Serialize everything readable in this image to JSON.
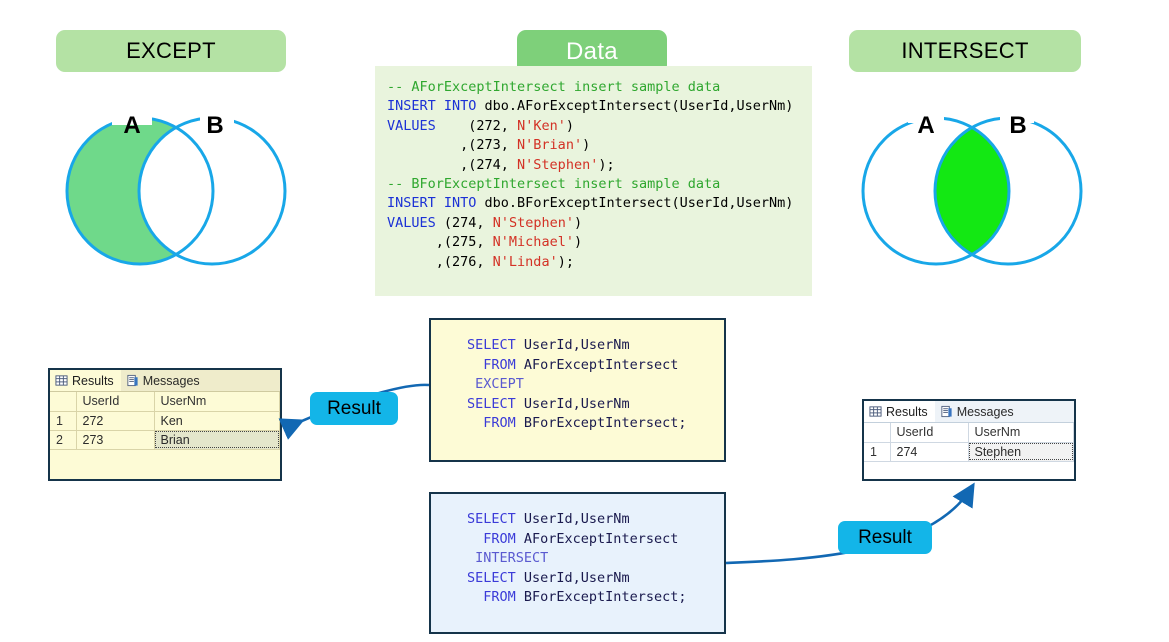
{
  "sections": {
    "except_title": "EXCEPT",
    "data_title": "Data",
    "intersect_title": "INTERSECT"
  },
  "venn": {
    "except": {
      "label_a": "A",
      "label_b": "B",
      "fill_color": "#6fd98a",
      "stroke_color": "#18a7e8",
      "shaded_region": "A only"
    },
    "intersect": {
      "label_a": "A",
      "label_b": "B",
      "fill_color": "#13e813",
      "stroke_color": "#18a7e8",
      "shaded_region": "A and B"
    }
  },
  "data_panel": {
    "background": "#e9f4dd",
    "lines": [
      [
        {
          "t": "-- AForExceptIntersect insert sample data",
          "c": "c"
        }
      ],
      [
        {
          "t": "INSERT INTO ",
          "c": "k"
        },
        {
          "t": "dbo.AForExceptIntersect(UserId,UserNm)",
          "c": "n"
        }
      ],
      [
        {
          "t": "VALUES ",
          "c": "k"
        },
        {
          "t": "   (272, ",
          "c": "n"
        },
        {
          "t": "N'Ken'",
          "c": "s"
        },
        {
          "t": ")",
          "c": "n"
        }
      ],
      [
        {
          "t": "         ,(273, ",
          "c": "n"
        },
        {
          "t": "N'Brian'",
          "c": "s"
        },
        {
          "t": ")",
          "c": "n"
        }
      ],
      [
        {
          "t": "         ,(274, ",
          "c": "n"
        },
        {
          "t": "N'Stephen'",
          "c": "s"
        },
        {
          "t": ");",
          "c": "n"
        }
      ],
      [
        {
          "t": "-- BForExceptIntersect insert sample data",
          "c": "c"
        }
      ],
      [
        {
          "t": "INSERT INTO ",
          "c": "k"
        },
        {
          "t": "dbo.BForExceptIntersect(UserId,UserNm)",
          "c": "n"
        }
      ],
      [
        {
          "t": "VALUES ",
          "c": "k"
        },
        {
          "t": "(274, ",
          "c": "n"
        },
        {
          "t": "N'Stephen'",
          "c": "s"
        },
        {
          "t": ")",
          "c": "n"
        }
      ],
      [
        {
          "t": "      ,(275, ",
          "c": "n"
        },
        {
          "t": "N'Michael'",
          "c": "s"
        },
        {
          "t": ")",
          "c": "n"
        }
      ],
      [
        {
          "t": "      ,(276, ",
          "c": "n"
        },
        {
          "t": "N'Linda'",
          "c": "s"
        },
        {
          "t": ");",
          "c": "n"
        }
      ]
    ]
  },
  "sql_except": {
    "background": "#fdfbd6",
    "border": "#15344a",
    "lines": [
      [
        {
          "t": "SELECT ",
          "c": "sk"
        },
        {
          "t": "UserId,UserNm",
          "c": "sid"
        }
      ],
      [
        {
          "t": "  FROM ",
          "c": "sk"
        },
        {
          "t": "AForExceptIntersect",
          "c": "sid"
        }
      ],
      [
        {
          "t": " EXCEPT",
          "c": "sop"
        }
      ],
      [
        {
          "t": "SELECT ",
          "c": "sk"
        },
        {
          "t": "UserId,UserNm",
          "c": "sid"
        }
      ],
      [
        {
          "t": "  FROM ",
          "c": "sk"
        },
        {
          "t": "BForExceptIntersect;",
          "c": "sid"
        }
      ]
    ]
  },
  "sql_intersect": {
    "background": "#e8f2fc",
    "border": "#15344a",
    "lines": [
      [
        {
          "t": "SELECT ",
          "c": "sk"
        },
        {
          "t": "UserId,UserNm",
          "c": "sid"
        }
      ],
      [
        {
          "t": "  FROM ",
          "c": "sk"
        },
        {
          "t": "AForExceptIntersect",
          "c": "sid"
        }
      ],
      [
        {
          "t": " INTERSECT",
          "c": "sop"
        }
      ],
      [
        {
          "t": "SELECT ",
          "c": "sk"
        },
        {
          "t": "UserId,UserNm",
          "c": "sid"
        }
      ],
      [
        {
          "t": "  FROM ",
          "c": "sk"
        },
        {
          "t": "BForExceptIntersect;",
          "c": "sid"
        }
      ]
    ]
  },
  "result_labels": {
    "left": "Result",
    "right": "Result",
    "color": "#13b5e8"
  },
  "grid_except": {
    "tabs": [
      {
        "label": "Results",
        "icon": "grid-icon",
        "active": true
      },
      {
        "label": "Messages",
        "icon": "report-icon",
        "active": false
      }
    ],
    "columns": [
      "",
      "UserId",
      "UserNm"
    ],
    "rows": [
      {
        "num": "1",
        "UserId": "272",
        "UserNm": "Ken",
        "selected": false
      },
      {
        "num": "2",
        "UserId": "273",
        "UserNm": "Brian",
        "selected": true
      }
    ]
  },
  "grid_intersect": {
    "tabs": [
      {
        "label": "Results",
        "icon": "grid-icon",
        "active": true
      },
      {
        "label": "Messages",
        "icon": "report-icon",
        "active": false
      }
    ],
    "columns": [
      "",
      "UserId",
      "UserNm"
    ],
    "rows": [
      {
        "num": "1",
        "UserId": "274",
        "UserNm": "Stephen",
        "selected": true
      }
    ]
  },
  "connector_color": "#1268b3"
}
